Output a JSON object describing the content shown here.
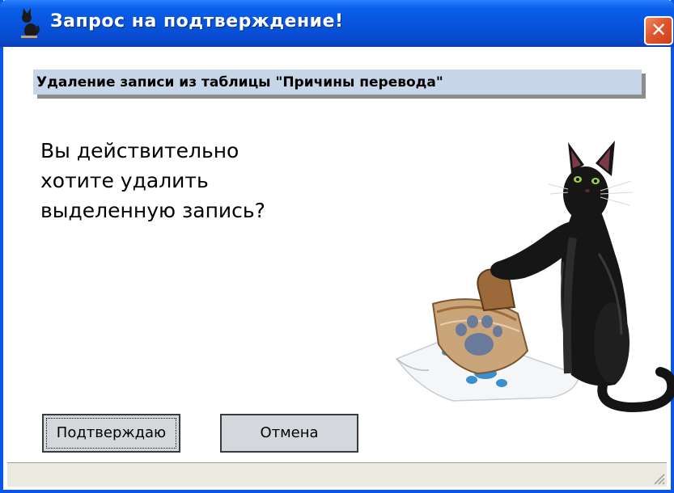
{
  "window": {
    "title": "Запрос на подтверждение!",
    "close_label": "✕"
  },
  "header": {
    "text": "Удаление записи из таблицы \"Причины перевода\""
  },
  "message": {
    "line1": "Вы действительно",
    "line2": "хотите удалить",
    "line3": "выделенную запись?"
  },
  "buttons": {
    "confirm_label": "Подтверждаю",
    "cancel_label": "Отмена"
  },
  "icons": {
    "title": "cat-icon",
    "illustration": "cat-stamp-illustration",
    "resize": "resize-grip-icon"
  },
  "colors": {
    "titlebar": "#0753dd",
    "close_button": "#e0562c",
    "header_band": "#c6d5e8",
    "button_face": "#d4d8dc"
  }
}
